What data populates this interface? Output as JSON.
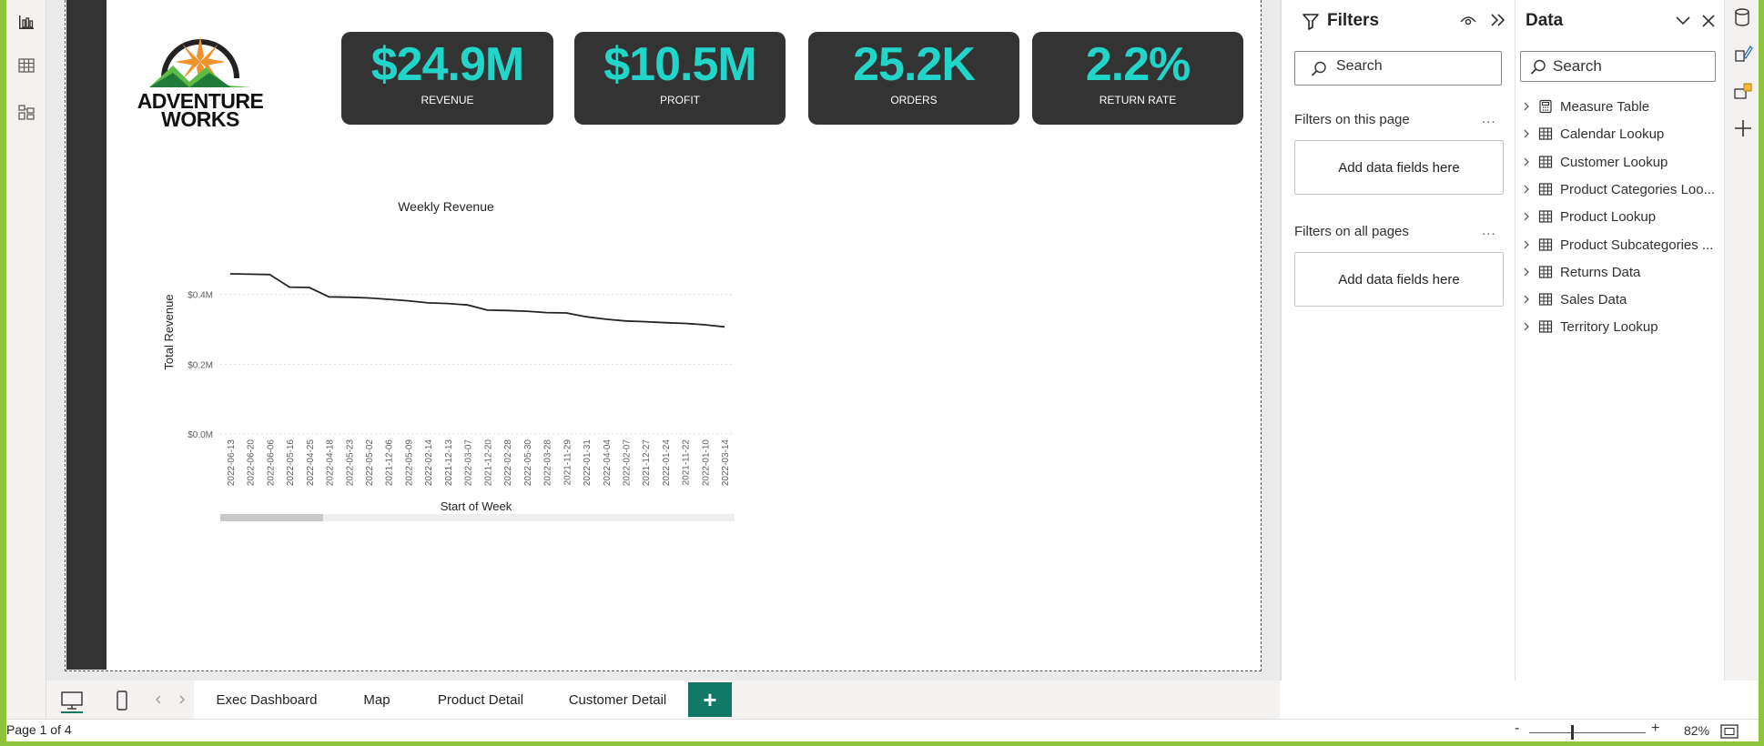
{
  "logo": {
    "line1": "ADVENTURE",
    "line2": "WORKS"
  },
  "kpis": [
    {
      "value": "$24.9M",
      "label": "REVENUE"
    },
    {
      "value": "$10.5M",
      "label": "PROFIT"
    },
    {
      "value": "25.2K",
      "label": "ORDERS"
    },
    {
      "value": "2.2%",
      "label": "RETURN RATE"
    }
  ],
  "chart_data": {
    "type": "line",
    "title": "Weekly Revenue",
    "xlabel": "Start of Week",
    "ylabel": "Total Revenue",
    "y_ticks": [
      "$0.0M",
      "$0.2M",
      "$0.4M"
    ],
    "ylim": [
      0,
      0.48
    ],
    "grid": true,
    "x": [
      "2022-06-13",
      "2022-06-20",
      "2022-06-06",
      "2022-05-16",
      "2022-04-25",
      "2022-04-18",
      "2022-05-23",
      "2022-05-02",
      "2021-12-06",
      "2022-05-09",
      "2022-02-14",
      "2021-12-13",
      "2022-03-07",
      "2021-12-20",
      "2022-02-28",
      "2022-05-30",
      "2022-03-28",
      "2021-11-29",
      "2022-01-31",
      "2022-04-04",
      "2022-02-07",
      "2021-12-27",
      "2022-01-24",
      "2021-11-22",
      "2022-01-10",
      "2022-03-14"
    ],
    "values": [
      0.459,
      0.458,
      0.457,
      0.421,
      0.42,
      0.393,
      0.392,
      0.39,
      0.386,
      0.382,
      0.376,
      0.374,
      0.37,
      0.355,
      0.354,
      0.352,
      0.348,
      0.347,
      0.336,
      0.329,
      0.324,
      0.322,
      0.319,
      0.317,
      0.313,
      0.307
    ],
    "scroll_position": 0.2
  },
  "filters": {
    "title": "Filters",
    "search_placeholder": "Search",
    "section_page": "Filters on this page",
    "section_all": "Filters on all pages",
    "drop_text": "Add data fields here",
    "more": "..."
  },
  "data_pane": {
    "title": "Data",
    "search_placeholder": "Search",
    "items": [
      "Measure Table",
      "Calendar Lookup",
      "Customer Lookup",
      "Product Categories Loo...",
      "Product Lookup",
      "Product Subcategories ...",
      "Returns Data",
      "Sales Data",
      "Territory Lookup"
    ]
  },
  "tabs": [
    "Exec Dashboard",
    "Map",
    "Product Detail",
    "Customer Detail"
  ],
  "add_tab": "+",
  "status": {
    "page": "Page 1 of 4",
    "zoom": "82%",
    "zoom_minus": "-",
    "zoom_plus": "+"
  },
  "colors": {
    "accent": "#22d5c9",
    "tab_active": "#117865",
    "frame": "#8fc43a",
    "card_bg": "#333333"
  }
}
